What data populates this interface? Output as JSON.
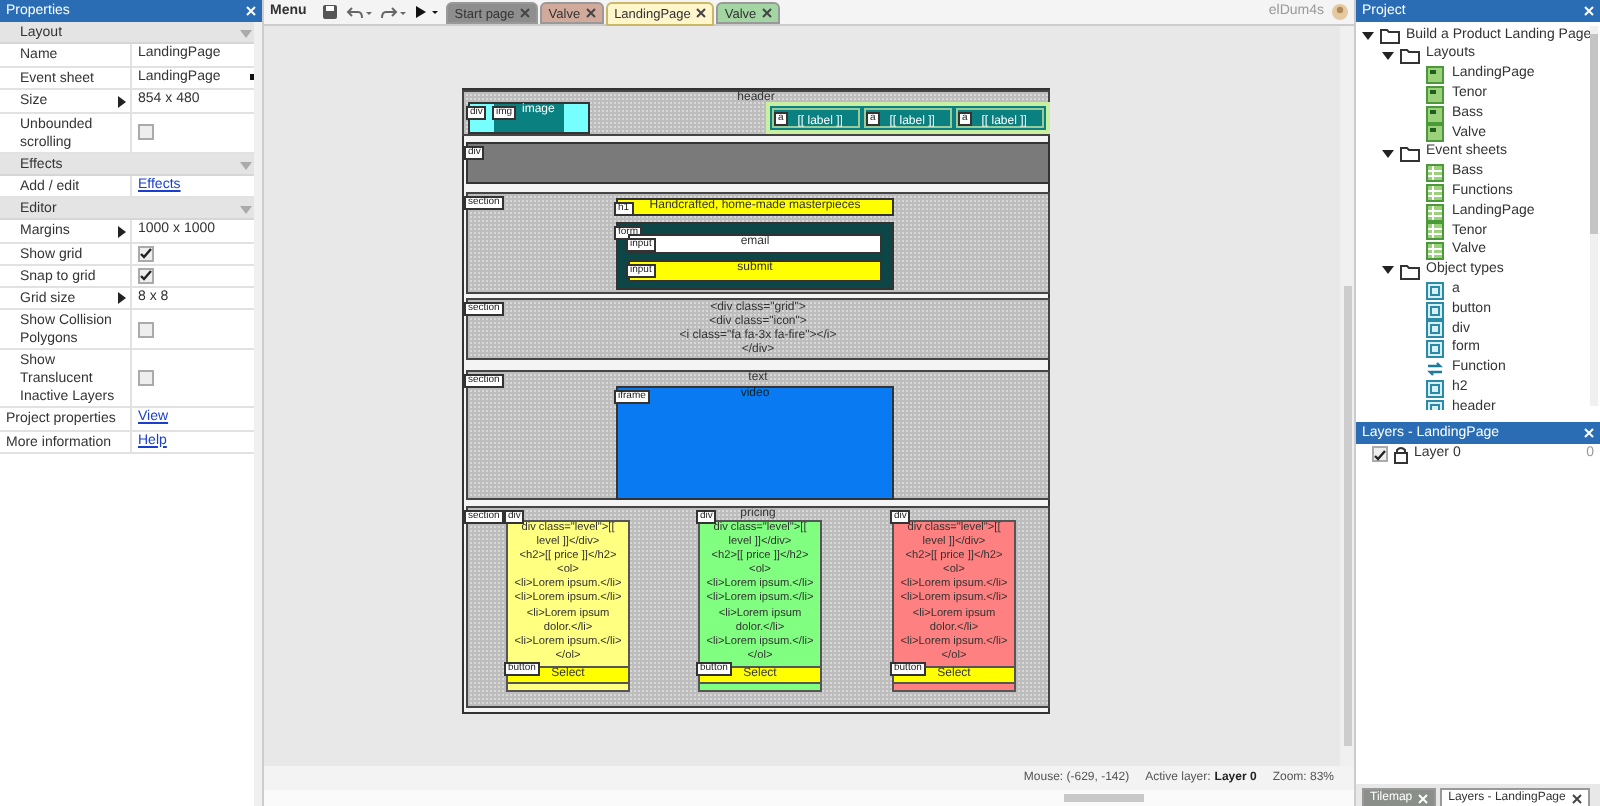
{
  "properties": {
    "title": "Properties",
    "groups": [
      {
        "name": "Layout",
        "expanded": true,
        "rows": [
          {
            "label": "Name",
            "kind": "text",
            "value": "LandingPage"
          },
          {
            "label": "Event sheet",
            "kind": "dropdown",
            "value": "LandingPage"
          },
          {
            "label": "Size",
            "kind": "expander",
            "value": "854 x 480"
          },
          {
            "label": "Unbounded scrolling",
            "kind": "checkbox",
            "checked": false
          }
        ]
      },
      {
        "name": "Effects",
        "expanded": true,
        "rows": [
          {
            "label": "Add / edit",
            "kind": "link",
            "value": "Effects"
          }
        ]
      },
      {
        "name": "Editor",
        "expanded": true,
        "rows": [
          {
            "label": "Margins",
            "kind": "expander",
            "value": "1000 x 1000"
          },
          {
            "label": "Show grid",
            "kind": "checkbox",
            "checked": true
          },
          {
            "label": "Snap to grid",
            "kind": "checkbox",
            "checked": true
          },
          {
            "label": "Grid size",
            "kind": "expander",
            "value": "8 x 8"
          },
          {
            "label": "Show Collision Polygons",
            "kind": "checkbox",
            "checked": false
          },
          {
            "label": "Show Translucent Inactive Layers",
            "kind": "checkbox",
            "checked": false
          }
        ]
      }
    ],
    "footer_rows": [
      {
        "label": "Project properties",
        "kind": "link",
        "value": "View"
      },
      {
        "label": "More information",
        "kind": "link",
        "value": "Help"
      }
    ]
  },
  "toolbar": {
    "menu": "Menu",
    "tabs": [
      {
        "label": "Start page",
        "color": "#8e8e8e",
        "selected": false
      },
      {
        "label": "Valve",
        "color": "#d2aa9c",
        "selected": false
      },
      {
        "label": "LandingPage",
        "color": "#fff6cc",
        "selected": true
      },
      {
        "label": "Valve",
        "color": "#a4d6a4",
        "selected": false
      }
    ],
    "user": "elDum4s"
  },
  "layout": {
    "objects": [
      {
        "kind": "section",
        "title": "header"
      },
      {
        "kind": "image",
        "tags": [
          "div",
          "img"
        ],
        "text": "image"
      },
      {
        "kind": "nav",
        "links": [
          {
            "tag": "a",
            "text": "[[ label ]]"
          },
          {
            "tag": "a",
            "text": "[[ label ]]"
          },
          {
            "tag": "a",
            "text": "[[ label ]]"
          }
        ]
      },
      {
        "kind": "block",
        "color": "#7a7a7a",
        "tags": [
          "div"
        ]
      },
      {
        "kind": "section",
        "tags": [
          "section"
        ]
      },
      {
        "kind": "block",
        "color": "#ffff00",
        "tags": [
          "h1"
        ],
        "text": "Handcrafted, home-made masterpieces"
      },
      {
        "kind": "block",
        "color": "#0c4646",
        "tags": [
          "form"
        ]
      },
      {
        "kind": "block",
        "color": "#ffffff",
        "tags": [
          "input"
        ],
        "text": "email"
      },
      {
        "kind": "block",
        "color": "#ffff00",
        "tags": [
          "input"
        ],
        "text": "submit"
      },
      {
        "kind": "section",
        "tags": [
          "section"
        ],
        "text": "<div class=\"grid\">\n<div class=\"icon\">\n<i class=\"fa fa-3x fa-fire\"></i>\n</div>"
      },
      {
        "kind": "section",
        "tags": [
          "section"
        ],
        "title": "text"
      },
      {
        "kind": "block",
        "color": "#0a7af2",
        "tags": [
          "iframe"
        ],
        "text": "video"
      },
      {
        "kind": "section",
        "tags": [
          "section"
        ],
        "title": "pricing"
      },
      {
        "kind": "card",
        "color": "#ffff80",
        "tags": [
          "div"
        ],
        "text": "div class=\"level\">[[\nlevel ]]</div>\n<h2>[[ price ]]</h2>\n<ol>\n<li>Lorem ipsum.</li>\n<li>Lorem ipsum.</li>\n<li>Lorem ipsum\ndolor.</li>\n<li>Lorem ipsum.</li>\n</ol>",
        "button": {
          "tag": "button",
          "label": "Select"
        }
      },
      {
        "kind": "card",
        "color": "#80ff80",
        "tags": [
          "div"
        ],
        "text": "div class=\"level\">[[\nlevel ]]</div>\n<h2>[[ price ]]</h2>\n<ol>\n<li>Lorem ipsum.</li>\n<li>Lorem ipsum.</li>\n<li>Lorem ipsum\ndolor.</li>\n<li>Lorem ipsum.</li>\n</ol>",
        "button": {
          "tag": "button",
          "label": "Select"
        }
      },
      {
        "kind": "card",
        "color": "#ff8080",
        "tags": [
          "div"
        ],
        "text": "div class=\"level\">[[\nlevel ]]</div>\n<h2>[[ price ]]</h2>\n<ol>\n<li>Lorem ipsum.</li>\n<li>Lorem ipsum.</li>\n<li>Lorem ipsum\ndolor.</li>\n<li>Lorem ipsum.</li>\n</ol>",
        "button": {
          "tag": "button",
          "label": "Select"
        }
      }
    ]
  },
  "status_bar": {
    "mouse": "Mouse: (-629, -142)",
    "active_layer_label": "Active layer:",
    "active_layer": "Layer 0",
    "zoom": "Zoom: 83%"
  },
  "project": {
    "title": "Project",
    "tree": [
      {
        "label": "Build a Product Landing Page",
        "kind": "folder",
        "expanded": true,
        "children": [
          {
            "label": "Layouts",
            "kind": "folder",
            "expanded": true,
            "children": [
              {
                "label": "LandingPage",
                "kind": "layout"
              },
              {
                "label": "Tenor",
                "kind": "layout"
              },
              {
                "label": "Bass",
                "kind": "layout"
              },
              {
                "label": "Valve",
                "kind": "layout"
              }
            ]
          },
          {
            "label": "Event sheets",
            "kind": "folder",
            "expanded": true,
            "children": [
              {
                "label": "Bass",
                "kind": "eventsheet"
              },
              {
                "label": "Functions",
                "kind": "eventsheet"
              },
              {
                "label": "LandingPage",
                "kind": "eventsheet"
              },
              {
                "label": "Tenor",
                "kind": "eventsheet"
              },
              {
                "label": "Valve",
                "kind": "eventsheet"
              }
            ]
          },
          {
            "label": "Object types",
            "kind": "folder",
            "expanded": true,
            "children": [
              {
                "label": "a",
                "kind": "object"
              },
              {
                "label": "button",
                "kind": "object"
              },
              {
                "label": "div",
                "kind": "object"
              },
              {
                "label": "form",
                "kind": "object"
              },
              {
                "label": "Function",
                "kind": "function"
              },
              {
                "label": "h2",
                "kind": "object"
              },
              {
                "label": "header",
                "kind": "object"
              }
            ]
          }
        ]
      }
    ]
  },
  "layers": {
    "title": "Layers - LandingPage",
    "items": [
      {
        "name": "Layer 0",
        "visible": true,
        "count": "0"
      }
    ]
  },
  "bottom_tabs": [
    {
      "label": "Tilemap",
      "selected": false
    },
    {
      "label": "Layers - LandingPage",
      "selected": true
    }
  ]
}
